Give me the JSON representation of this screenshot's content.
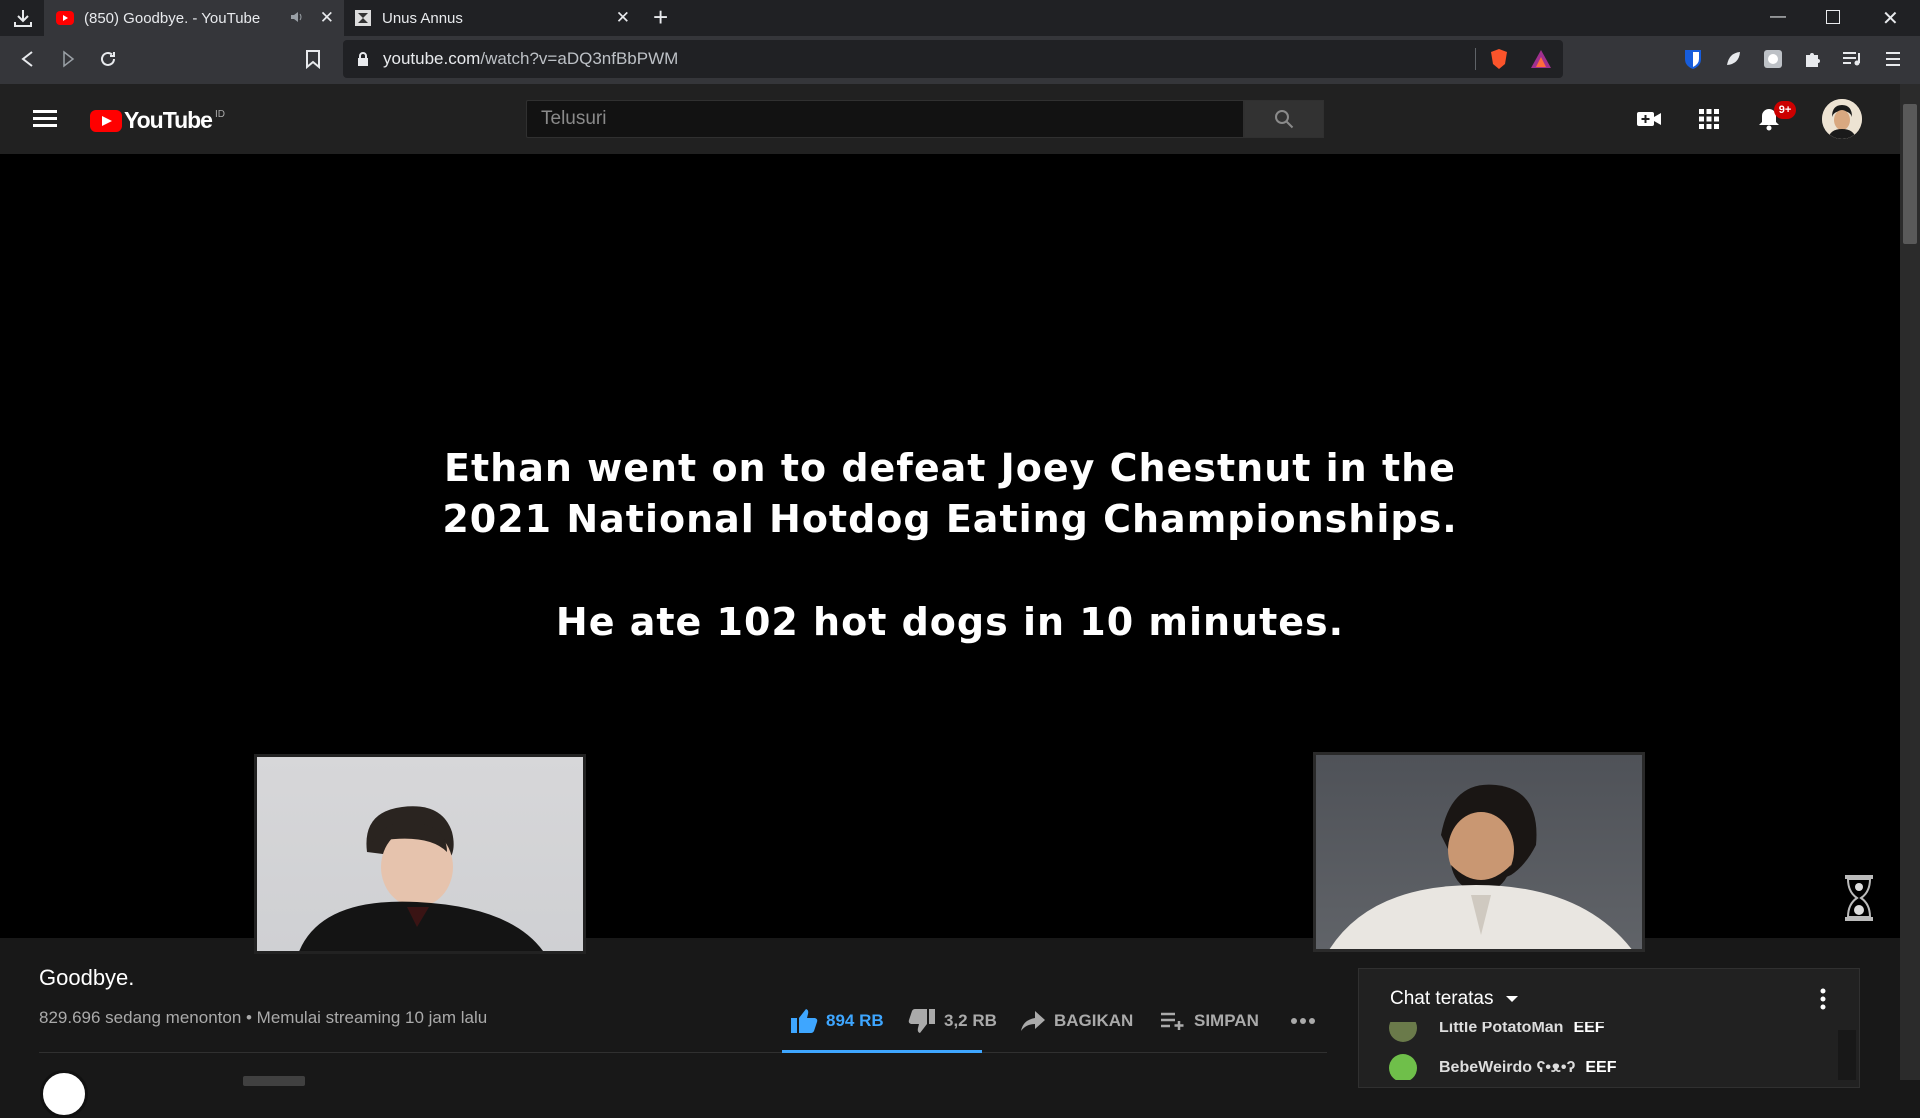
{
  "browser": {
    "tabs": [
      {
        "title": "(850) Goodbye. - YouTube",
        "active": true
      },
      {
        "title": "Unus Annus",
        "active": false
      }
    ],
    "url_host": "youtube.com",
    "url_path": "/watch?v=aDQ3nfBbPWM",
    "new_tab_label": "+"
  },
  "youtube": {
    "logo_text": "YouTube",
    "country_code": "ID",
    "search_placeholder": "Telusuri",
    "notification_count": "9+"
  },
  "video": {
    "caption_line1": "Ethan went on to defeat Joey Chestnut in the",
    "caption_line2": "2021 National Hotdog Eating Championships.",
    "caption_line3": "He ate 102 hot dogs in 10 minutes.",
    "title": "Goodbye.",
    "meta": "829.696 sedang menonton • Memulai streaming 10 jam lalu"
  },
  "actions": {
    "like_count": "894 RB",
    "dislike_count": "3,2 RB",
    "share_label": "BAGIKAN",
    "save_label": "SIMPAN"
  },
  "chat": {
    "header": "Chat teratas",
    "messages": [
      {
        "author": "Little PotatoMan",
        "text": "EEF"
      },
      {
        "author": "BebeWeirdo ʕ•ᴥ•ʔ",
        "text": "EEF"
      }
    ]
  },
  "colors": {
    "accent": "#3ea6ff",
    "youtube_red": "#ff0000",
    "badge_red": "#cc0000"
  }
}
